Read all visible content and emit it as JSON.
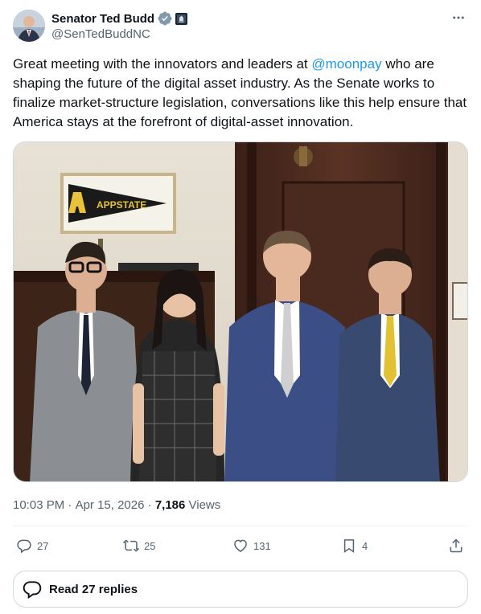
{
  "author": {
    "display_name": "Senator Ted Budd",
    "handle": "@SenTedBuddNC"
  },
  "tweet": {
    "text_before": "Great meeting with the innovators and leaders at ",
    "mention": "@moonpay",
    "text_after": " who are shaping the future of the digital asset industry. As the Senate works to finalize market-structure legislation, conversations like this help ensure that America stays at the forefront of digital-asset innovation.",
    "photo_pennant_text": "APPSTATE"
  },
  "meta": {
    "time": "10:03 PM",
    "separator1": " · ",
    "date": "Apr 15, 2026",
    "separator2": " · ",
    "views_count": "7,186",
    "views_label": " Views"
  },
  "actions": {
    "replies": "27",
    "reposts": "25",
    "likes": "131",
    "bookmarks": "4"
  },
  "read_replies_label": "Read 27 replies",
  "colors": {
    "accent": "#1d9bf0",
    "text": "#0f1419",
    "muted": "#536471",
    "border": "#cfd9de"
  },
  "icons": [
    "verified-badge-icon",
    "government-label-icon",
    "more-icon",
    "reply-icon",
    "repost-icon",
    "like-icon",
    "bookmark-icon",
    "share-icon",
    "speech-bubble-icon"
  ]
}
